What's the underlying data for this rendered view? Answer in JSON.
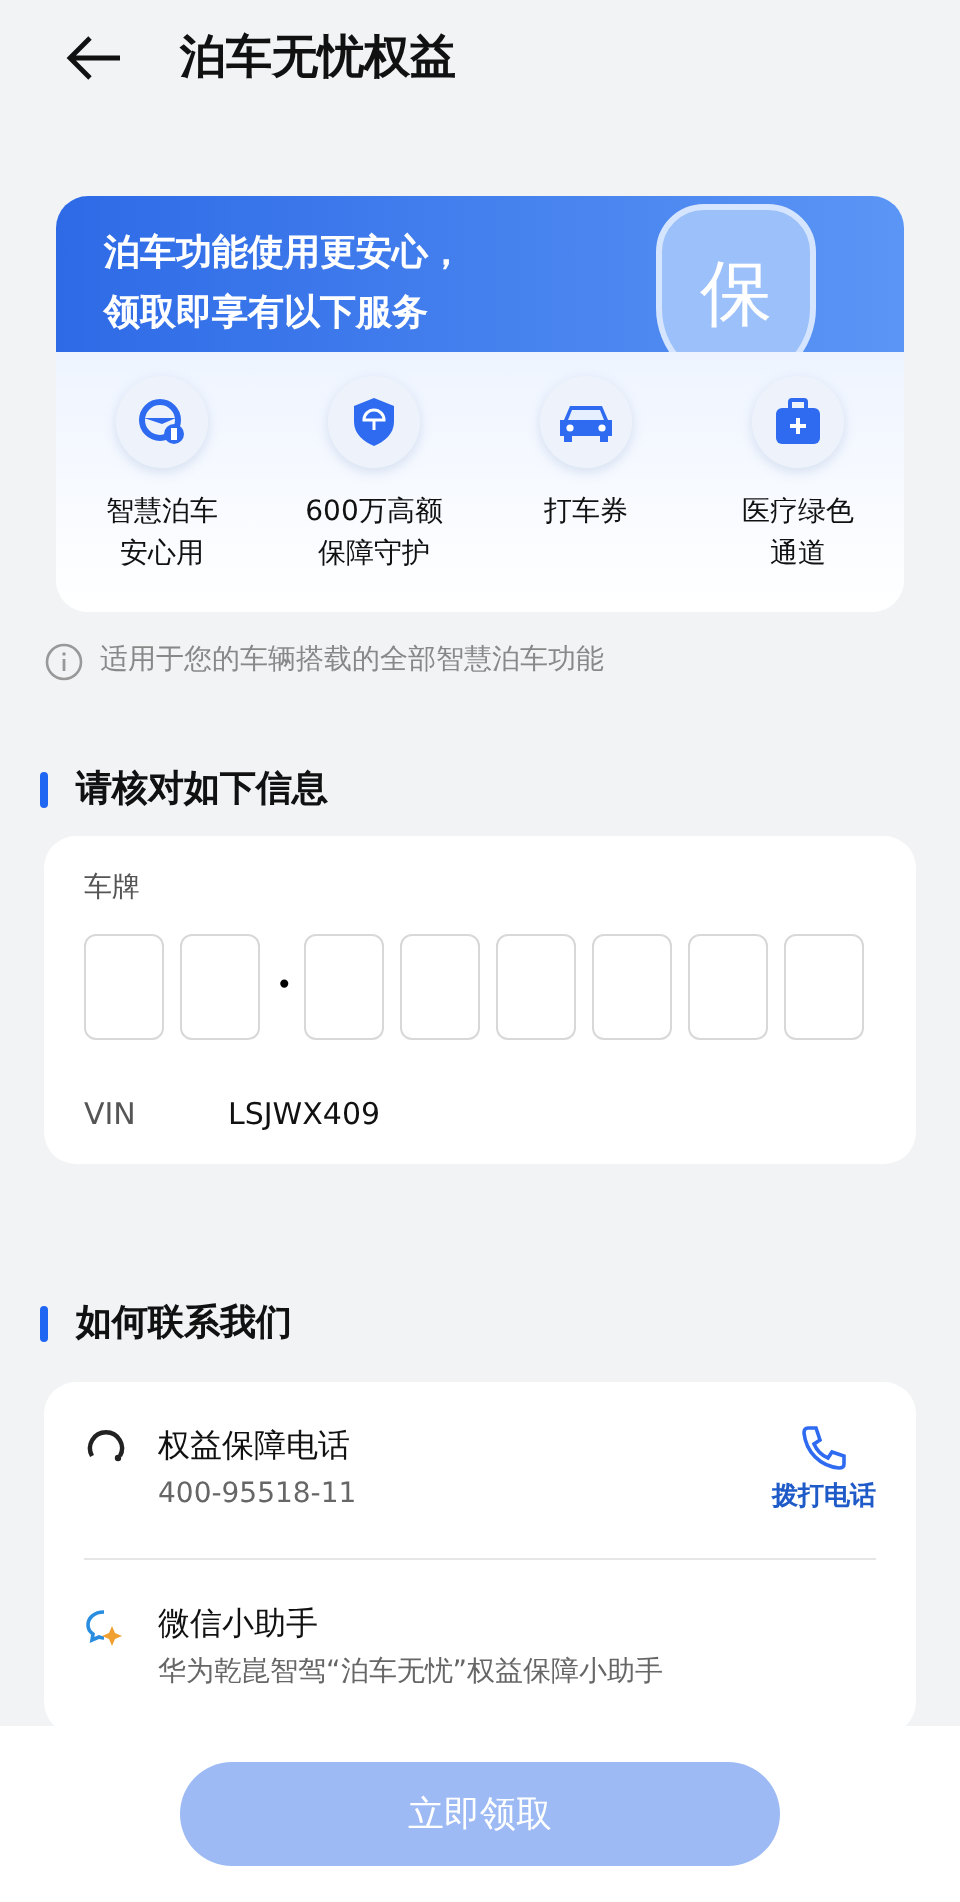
{
  "header": {
    "title": "泊车无忧权益"
  },
  "banner": {
    "headline": "泊车功能使用更安心，",
    "subline": "领取即享有以下服务",
    "badge": "保",
    "services": [
      {
        "kind": "parking",
        "line1": "智慧泊车",
        "line2": "安心用"
      },
      {
        "kind": "shield",
        "line1": "600万高额",
        "line2": "保障守护"
      },
      {
        "kind": "car",
        "line1": "打车券"
      },
      {
        "kind": "medical",
        "line1": "医疗绿色",
        "line2": "通道"
      }
    ]
  },
  "notice": "适用于您的车辆搭载的全部智慧泊车功能",
  "verify": {
    "heading": "请核对如下信息",
    "plate_label": "车牌",
    "plate_cells": [
      {
        "kind": "slot"
      },
      {
        "kind": "slot"
      },
      {
        "kind": "dot",
        "text": "•"
      },
      {
        "kind": "slot"
      },
      {
        "kind": "slot"
      },
      {
        "kind": "slot"
      },
      {
        "kind": "slot"
      },
      {
        "kind": "slot"
      },
      {
        "kind": "slot"
      }
    ],
    "vin_label": "VIN",
    "vin_value": "LSJWX409"
  },
  "contact": {
    "heading": "如何联系我们",
    "items": [
      {
        "kind": "phone",
        "title": "权益保障电话",
        "detail": "400-95518-11",
        "action": "拨打电话"
      },
      {
        "kind": "wechat",
        "title": "微信小助手",
        "detail": "华为乾崑智驾“泊车无忧”权益保障小助手"
      }
    ]
  },
  "claim_button": {
    "label": "立即领取",
    "disabled": true
  }
}
